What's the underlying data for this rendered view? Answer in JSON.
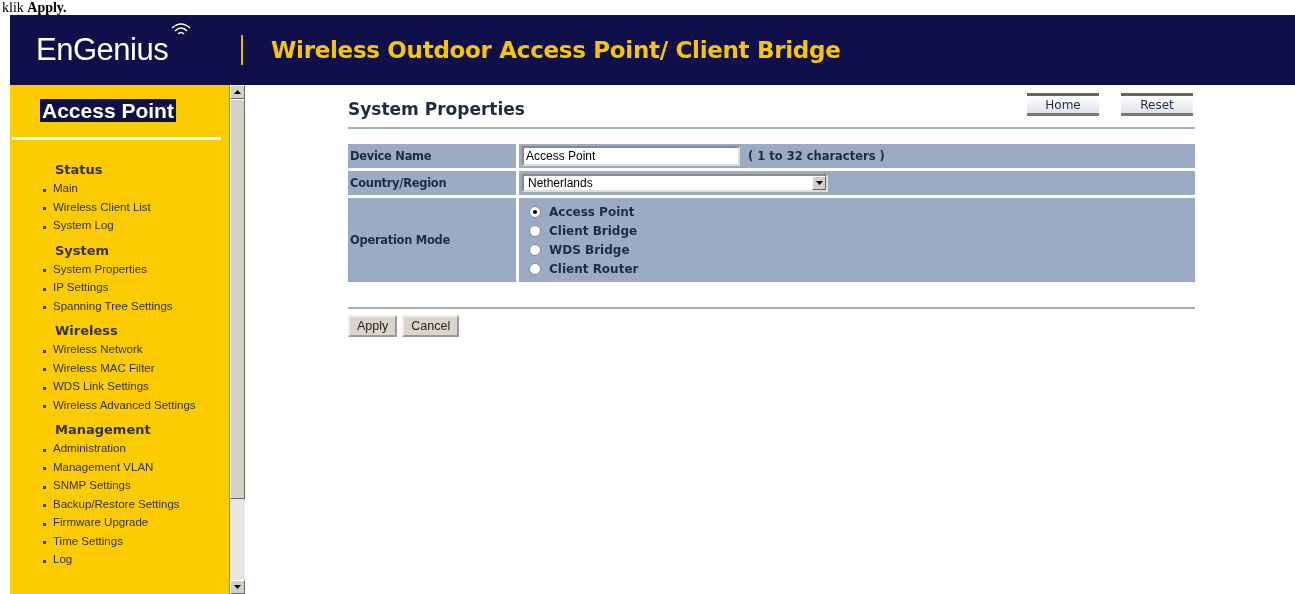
{
  "caption": "klik **Apply.**",
  "header": {
    "logo": "EnGenius",
    "title": "Wireless Outdoor Access Point/ Client Bridge"
  },
  "sidebar": {
    "title": "Access Point",
    "sections": [
      {
        "heading": "Status",
        "items": [
          "Main",
          "Wireless Client List",
          "System Log"
        ]
      },
      {
        "heading": "System",
        "items": [
          "System Properties",
          "IP Settings",
          "Spanning Tree Settings"
        ]
      },
      {
        "heading": "Wireless",
        "items": [
          "Wireless Network",
          "Wireless MAC Filter",
          "WDS Link Settings",
          "Wireless Advanced Settings"
        ]
      },
      {
        "heading": "Management",
        "items": [
          "Administration",
          "Management VLAN",
          "SNMP Settings",
          "Backup/Restore Settings",
          "Firmware Upgrade",
          "Time Settings",
          "Log"
        ]
      }
    ]
  },
  "page": {
    "title": "System Properties",
    "top_buttons": [
      "Home",
      "Reset"
    ],
    "device_name": {
      "label": "Device Name",
      "value": "Access Point",
      "hint": "( 1 to 32 characters )"
    },
    "country": {
      "label": "Country/Region",
      "value": "Netherlands"
    },
    "operation_mode": {
      "label": "Operation Mode",
      "options": [
        {
          "label": "Access Point",
          "selected": true
        },
        {
          "label": "Client Bridge",
          "selected": false
        },
        {
          "label": "WDS Bridge",
          "selected": false
        },
        {
          "label": "Client Router",
          "selected": false
        }
      ]
    },
    "buttons": [
      "Apply",
      "Cancel"
    ]
  }
}
